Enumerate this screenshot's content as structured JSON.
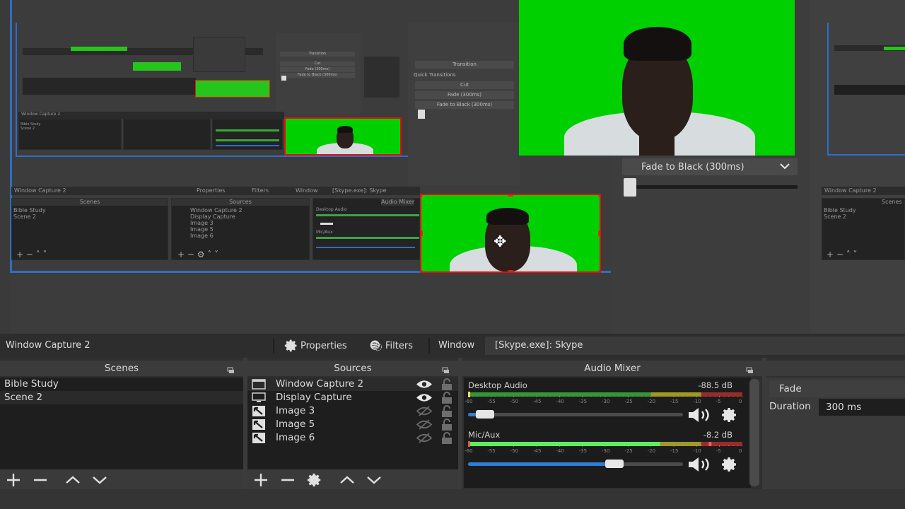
{
  "preview": {
    "transition_dropdown": "Fade to Black (300ms)",
    "mini_transition": {
      "header": "Transition",
      "quick_label": "Quick Transitions",
      "buttons": [
        "Cut",
        "Fade (300ms)",
        "Fade to Black (300ms)"
      ]
    },
    "mini_toolbar": {
      "source_name": "Window Capture 2",
      "properties": "Properties",
      "filters": "Filters",
      "window": "Window",
      "window_value": "[Skype.exe]: Skype"
    },
    "mini_docks": {
      "scenes_title": "Scenes",
      "sources_title": "Sources",
      "mixer_title": "Audio Mixer",
      "scenes": [
        "Bible Study",
        "Scene 2"
      ],
      "sources": [
        "Window Capture 2",
        "Display Capture",
        "Image 3",
        "Image 5",
        "Image 6"
      ],
      "mixer_channels": [
        "Desktop Audio",
        "Mic/Aux"
      ]
    },
    "green_screen_color": "#00d000",
    "selection_color": "#e01010"
  },
  "toolbar": {
    "source_name": "Window Capture 2",
    "properties_label": "Properties",
    "filters_label": "Filters",
    "window_label": "Window",
    "window_value": "[Skype.exe]: Skype"
  },
  "scenes": {
    "title": "Scenes",
    "items": [
      "Bible Study",
      "Scene 2"
    ]
  },
  "sources": {
    "title": "Sources",
    "items": [
      {
        "label": "Window Capture 2",
        "icon": "window-icon",
        "visible": true,
        "locked": false
      },
      {
        "label": "Display Capture",
        "icon": "monitor-icon",
        "visible": true,
        "locked": false
      },
      {
        "label": "Image 3",
        "icon": "image-icon",
        "visible": false,
        "locked": false
      },
      {
        "label": "Image 5",
        "icon": "image-icon",
        "visible": false,
        "locked": false
      },
      {
        "label": "Image 6",
        "icon": "image-icon",
        "visible": false,
        "locked": false
      }
    ]
  },
  "mixer": {
    "title": "Audio Mixer",
    "scale": [
      "-60",
      "-55",
      "-50",
      "-45",
      "-40",
      "-35",
      "-30",
      "-25",
      "-20",
      "-15",
      "-10",
      "-5",
      "0"
    ],
    "channels": [
      {
        "name": "Desktop Audio",
        "db": "-88.5 dB",
        "volume_fraction": 0.08,
        "level_fraction": 0.0
      },
      {
        "name": "Mic/Aux",
        "db": "-8.2 dB",
        "volume_fraction": 0.68,
        "level_fraction": 0.7
      }
    ],
    "colors": {
      "green": "#3fbf3f",
      "yellow": "#c9c32b",
      "red": "#c23030",
      "fader": "#2f7dd4"
    }
  },
  "transitions": {
    "selected": "Fade",
    "duration_label": "Duration",
    "duration_value": "300 ms"
  }
}
